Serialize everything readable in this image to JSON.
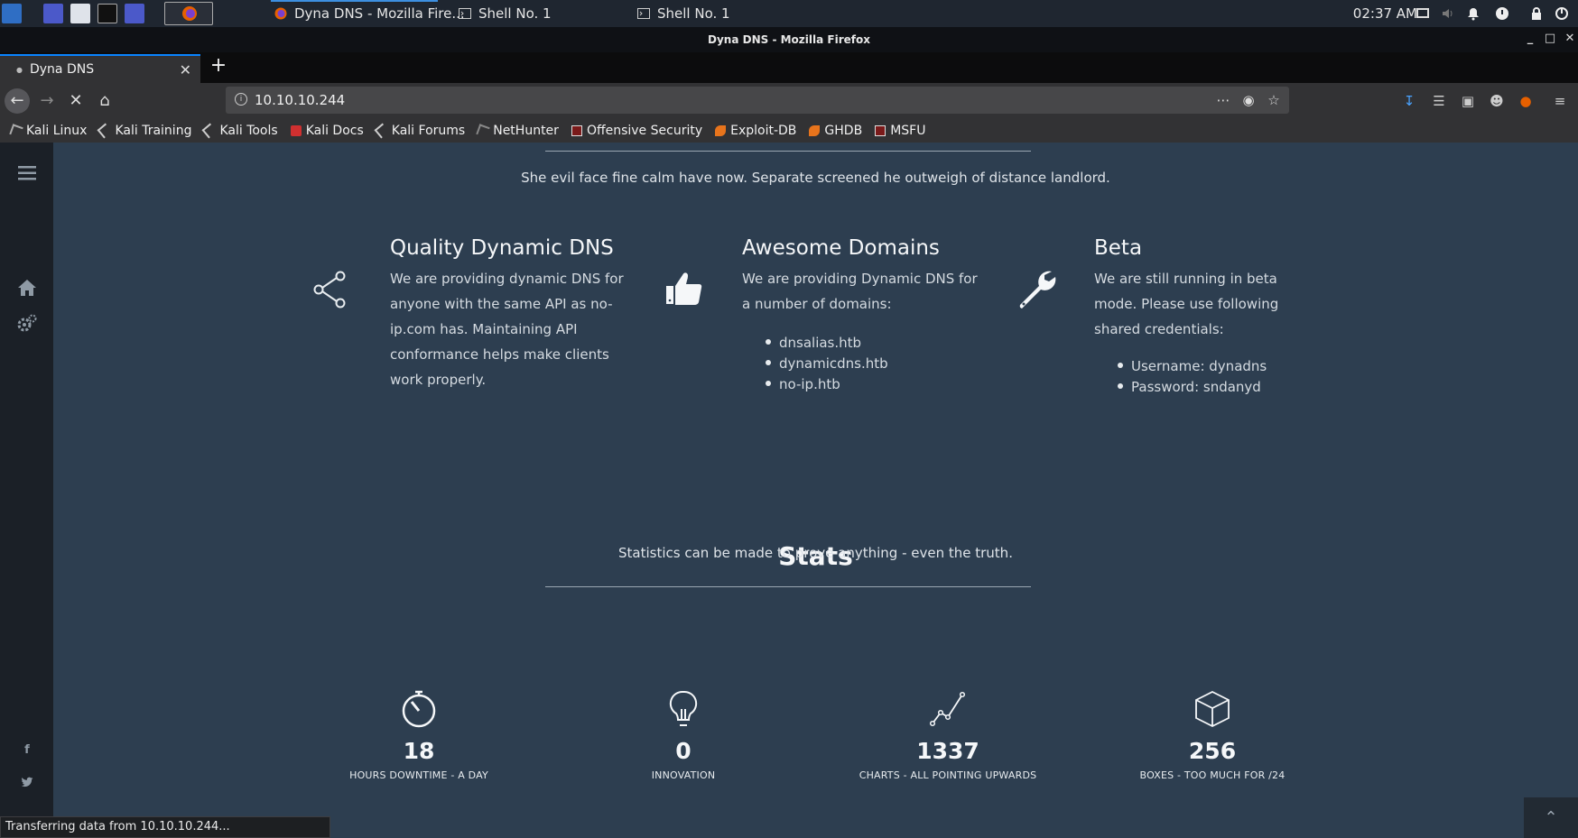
{
  "panel": {
    "tasks": [
      {
        "label": "Dyna DNS - Mozilla Fire..."
      },
      {
        "label": "Shell No. 1"
      },
      {
        "label": "Shell No. 1"
      }
    ],
    "clock": "02:37 AM"
  },
  "browser": {
    "window_title": "Dyna DNS - Mozilla Firefox",
    "tab_title": "Dyna DNS",
    "url": "10.10.10.244",
    "bookmarks": [
      {
        "label": "Kali Linux",
        "icon": "kali-dragon-icon"
      },
      {
        "label": "Kali Training",
        "icon": "kali-dragon-icon"
      },
      {
        "label": "Kali Tools",
        "icon": "kali-dragon-icon"
      },
      {
        "label": "Kali Docs",
        "icon": "docs-red-icon"
      },
      {
        "label": "Kali Forums",
        "icon": "kali-dragon-icon"
      },
      {
        "label": "NetHunter",
        "icon": "nethunter-icon"
      },
      {
        "label": "Offensive Security",
        "icon": "offsec-icon"
      },
      {
        "label": "Exploit-DB",
        "icon": "exploitdb-icon"
      },
      {
        "label": "GHDB",
        "icon": "exploitdb-icon"
      },
      {
        "label": "MSFU",
        "icon": "offsec-icon"
      }
    ],
    "status": "Transferring data from 10.10.10.244..."
  },
  "page": {
    "intro_text": "She evil face fine calm have now. Separate screened he outweigh of distance landlord.",
    "features": [
      {
        "icon": "share-icon",
        "title": "Quality Dynamic DNS",
        "text": "We are providing dynamic DNS for anyone with the same API as no-ip.com has. Maintaining API conformance helps make clients work properly."
      },
      {
        "icon": "thumbs-up-icon",
        "title": "Awesome Domains",
        "text": "We are providing Dynamic DNS for a number of domains:",
        "list": [
          "dnsalias.htb",
          "dynamicdns.htb",
          "no-ip.htb"
        ]
      },
      {
        "icon": "wrench-icon",
        "title": "Beta",
        "text": "We are still running in beta mode. Please use following shared credentials:",
        "list": [
          "Username: dynadns",
          "Password: sndanyd"
        ]
      }
    ],
    "stats_title": "Stats",
    "stats_subtitle": "Statistics can be made to prove anything - even the truth.",
    "stats": [
      {
        "icon": "stopwatch-icon",
        "value": "18",
        "label": "HOURS DOWNTIME - A DAY"
      },
      {
        "icon": "lightbulb-icon",
        "value": "0",
        "label": "INNOVATION"
      },
      {
        "icon": "line-chart-icon",
        "value": "1337",
        "label": "CHARTS - ALL POINTING UPWARDS"
      },
      {
        "icon": "cube-icon",
        "value": "256",
        "label": "BOXES - TOO MUCH FOR /24"
      }
    ],
    "social": {
      "facebook": "f",
      "twitter": "t"
    }
  }
}
